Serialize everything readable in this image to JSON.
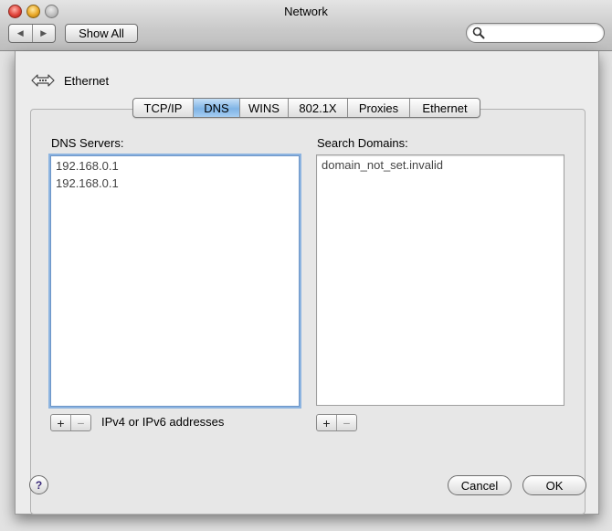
{
  "window": {
    "title": "Network"
  },
  "toolbar": {
    "back_glyph": "◀",
    "forward_glyph": "▶",
    "show_all_label": "Show All",
    "search_placeholder": ""
  },
  "sheet": {
    "interface_name": "Ethernet",
    "tabs": [
      {
        "label": "TCP/IP",
        "selected": false
      },
      {
        "label": "DNS",
        "selected": true
      },
      {
        "label": "WINS",
        "selected": false
      },
      {
        "label": "802.1X",
        "selected": false
      },
      {
        "label": "Proxies",
        "selected": false
      },
      {
        "label": "Ethernet",
        "selected": false
      }
    ],
    "dns_servers": {
      "label": "DNS Servers:",
      "entries": [
        "192.168.0.1",
        "192.168.0.1"
      ],
      "add_glyph": "+",
      "remove_glyph": "−",
      "hint": "IPv4 or IPv6 addresses"
    },
    "search_domains": {
      "label": "Search Domains:",
      "entries": [
        "domain_not_set.invalid"
      ],
      "add_glyph": "+",
      "remove_glyph": "−"
    },
    "help_glyph": "?",
    "cancel_label": "Cancel",
    "ok_label": "OK"
  },
  "colors": {
    "selected_tab": "#7fb4e6",
    "focus_ring": "#8db4e0",
    "close_button": "#e0443b",
    "minimize_button": "#e9a827"
  }
}
